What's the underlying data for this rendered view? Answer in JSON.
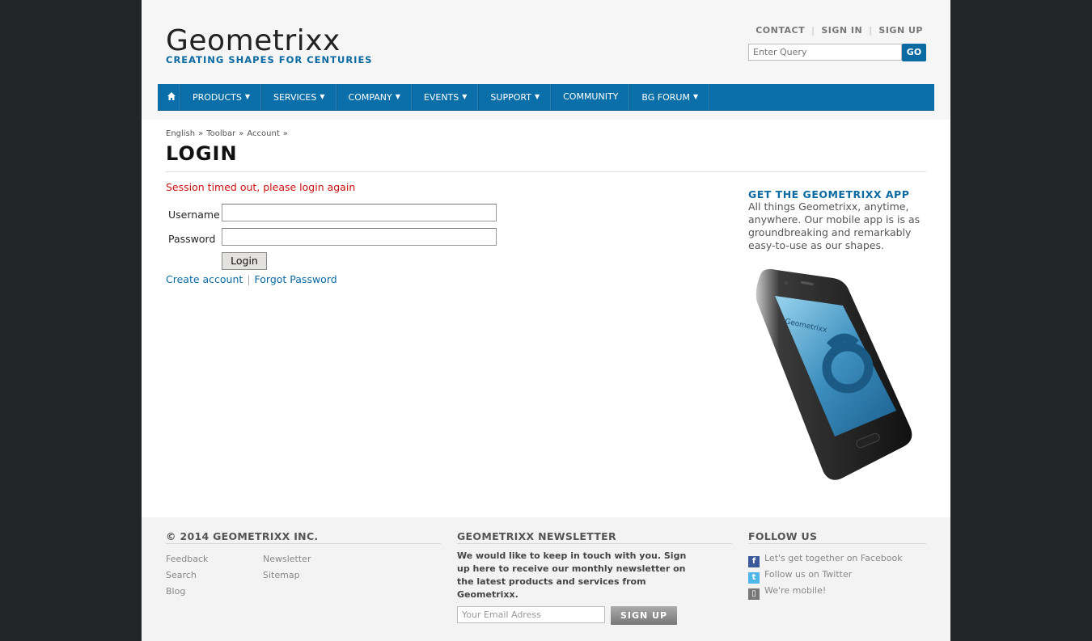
{
  "header": {
    "logo_title": "Geometrixx",
    "logo_tagline": "CREATING SHAPES FOR CENTURIES",
    "top_links": [
      "CONTACT",
      "SIGN IN",
      "SIGN UP"
    ],
    "search": {
      "placeholder": "Enter Query",
      "button_label": "GO"
    }
  },
  "nav": {
    "items": [
      {
        "label": "PRODUCTS",
        "has_dropdown": true
      },
      {
        "label": "SERVICES",
        "has_dropdown": true
      },
      {
        "label": "COMPANY",
        "has_dropdown": true
      },
      {
        "label": "EVENTS",
        "has_dropdown": true
      },
      {
        "label": "SUPPORT",
        "has_dropdown": true
      },
      {
        "label": "COMMUNITY",
        "has_dropdown": false
      },
      {
        "label": "BG FORUM",
        "has_dropdown": true
      }
    ]
  },
  "breadcrumb": [
    "English",
    "Toolbar",
    "Account"
  ],
  "main": {
    "title": "LOGIN",
    "error": "Session timed out, please login again",
    "username_label": "Username",
    "password_label": "Password",
    "login_button": "Login",
    "create_account": "Create account",
    "forgot_password": "Forgot Password"
  },
  "sidebar": {
    "app_title": "GET THE GEOMETRIXX APP",
    "app_text": "All things Geometrixx, anytime, anywhere. Our mobile app is is as groundbreaking and remarkably easy-to-use as our shapes.",
    "phone_screen_text": "Geometrixx"
  },
  "footer": {
    "copyright": "© 2014 GEOMETRIXX INC.",
    "links_col1": [
      "Feedback",
      "Search",
      "Blog"
    ],
    "links_col2": [
      "Newsletter",
      "Sitemap"
    ],
    "newsletter_title": "GEOMETRIXX NEWSLETTER",
    "newsletter_text": "We would like to keep in touch with you. Sign up here to receive our monthly newsletter on the latest products and services from Geometrixx.",
    "email_placeholder": "Your Email Adress",
    "signup_button": "SIGN UP",
    "follow_title": "FOLLOW US",
    "social": [
      {
        "label": "Let's get together on Facebook",
        "icon": "facebook-icon"
      },
      {
        "label": "Follow us on Twitter",
        "icon": "twitter-icon"
      },
      {
        "label": "We're mobile!",
        "icon": "mobile-icon"
      }
    ]
  },
  "colors": {
    "brand_blue": "#0a6aa1",
    "error_red": "#cc1111",
    "background_dark": "#222428"
  }
}
